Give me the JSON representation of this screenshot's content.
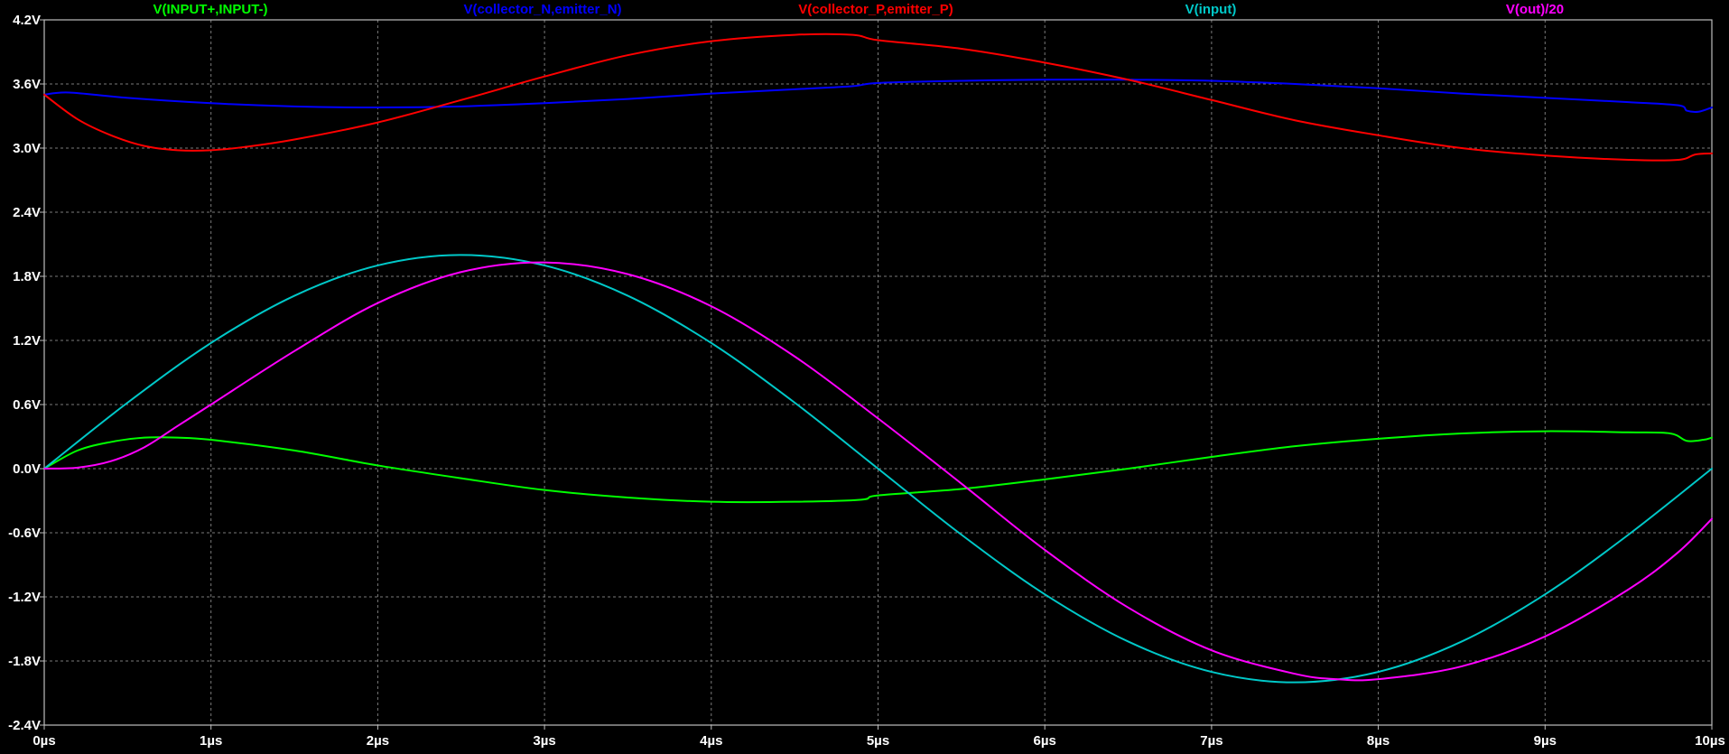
{
  "chart_data": {
    "type": "line",
    "title": "",
    "xlabel": "",
    "ylabel": "",
    "xlim": [
      0,
      10
    ],
    "ylim": [
      -2.4,
      4.2
    ],
    "x_unit": "µs",
    "y_unit": "V",
    "grid": true,
    "legend_position": "top",
    "x_ticks": [
      "0µs",
      "1µs",
      "2µs",
      "3µs",
      "4µs",
      "5µs",
      "6µs",
      "7µs",
      "8µs",
      "9µs",
      "10µs"
    ],
    "y_ticks": [
      "4.2V",
      "3.6V",
      "3.0V",
      "2.4V",
      "1.8V",
      "1.2V",
      "0.6V",
      "0.0V",
      "-0.6V",
      "-1.2V",
      "-1.8V",
      "-2.4V"
    ],
    "series": [
      {
        "name": "V(INPUT+,INPUT-)",
        "color": "#00ff00",
        "points": [
          [
            0,
            0
          ],
          [
            0.2,
            0.17
          ],
          [
            0.4,
            0.25
          ],
          [
            0.6,
            0.29
          ],
          [
            0.8,
            0.29
          ],
          [
            1.0,
            0.27
          ],
          [
            1.5,
            0.17
          ],
          [
            2.0,
            0.03
          ],
          [
            2.5,
            -0.09
          ],
          [
            3.0,
            -0.2
          ],
          [
            3.5,
            -0.27
          ],
          [
            4.0,
            -0.31
          ],
          [
            4.5,
            -0.31
          ],
          [
            4.9,
            -0.29
          ],
          [
            5.0,
            -0.25
          ],
          [
            5.5,
            -0.19
          ],
          [
            6.0,
            -0.1
          ],
          [
            6.5,
            0.0
          ],
          [
            7.0,
            0.11
          ],
          [
            7.5,
            0.21
          ],
          [
            8.0,
            0.28
          ],
          [
            8.5,
            0.33
          ],
          [
            9.0,
            0.35
          ],
          [
            9.5,
            0.34
          ],
          [
            9.75,
            0.33
          ],
          [
            9.85,
            0.26
          ],
          [
            9.95,
            0.27
          ],
          [
            10.0,
            0.29
          ]
        ]
      },
      {
        "name": "V(collector_N,emitter_N)",
        "color": "#0000ff",
        "points": [
          [
            0,
            3.5
          ],
          [
            0.15,
            3.52
          ],
          [
            0.5,
            3.47
          ],
          [
            1.0,
            3.42
          ],
          [
            1.5,
            3.39
          ],
          [
            2.0,
            3.38
          ],
          [
            2.5,
            3.39
          ],
          [
            3.0,
            3.42
          ],
          [
            3.5,
            3.46
          ],
          [
            4.0,
            3.51
          ],
          [
            4.5,
            3.55
          ],
          [
            4.85,
            3.58
          ],
          [
            5.0,
            3.61
          ],
          [
            5.5,
            3.63
          ],
          [
            6.0,
            3.64
          ],
          [
            6.5,
            3.64
          ],
          [
            7.0,
            3.63
          ],
          [
            7.5,
            3.6
          ],
          [
            8.0,
            3.56
          ],
          [
            8.5,
            3.51
          ],
          [
            9.0,
            3.47
          ],
          [
            9.5,
            3.43
          ],
          [
            9.8,
            3.4
          ],
          [
            9.85,
            3.35
          ],
          [
            9.92,
            3.34
          ],
          [
            10.0,
            3.38
          ]
        ]
      },
      {
        "name": "V(collector_P,emitter_P)",
        "color": "#ff0000",
        "points": [
          [
            0,
            3.5
          ],
          [
            0.2,
            3.27
          ],
          [
            0.4,
            3.12
          ],
          [
            0.6,
            3.02
          ],
          [
            0.8,
            2.98
          ],
          [
            1.0,
            2.98
          ],
          [
            1.2,
            3.01
          ],
          [
            1.5,
            3.08
          ],
          [
            2.0,
            3.24
          ],
          [
            2.5,
            3.45
          ],
          [
            3.0,
            3.67
          ],
          [
            3.5,
            3.87
          ],
          [
            4.0,
            4.0
          ],
          [
            4.5,
            4.06
          ],
          [
            4.85,
            4.06
          ],
          [
            5.0,
            4.01
          ],
          [
            5.5,
            3.93
          ],
          [
            6.0,
            3.8
          ],
          [
            6.5,
            3.64
          ],
          [
            7.0,
            3.45
          ],
          [
            7.5,
            3.26
          ],
          [
            8.0,
            3.12
          ],
          [
            8.5,
            3.0
          ],
          [
            9.0,
            2.93
          ],
          [
            9.5,
            2.89
          ],
          [
            9.8,
            2.89
          ],
          [
            9.9,
            2.94
          ],
          [
            10.0,
            2.95
          ]
        ]
      },
      {
        "name": "V(input)",
        "color": "#00c8c8",
        "points": [
          [
            0,
            0.0
          ],
          [
            0.5,
            0.618
          ],
          [
            1.0,
            1.176
          ],
          [
            1.5,
            1.618
          ],
          [
            2.0,
            1.902
          ],
          [
            2.5,
            2.0
          ],
          [
            3.0,
            1.902
          ],
          [
            3.5,
            1.618
          ],
          [
            4.0,
            1.176
          ],
          [
            4.5,
            0.618
          ],
          [
            5.0,
            0.0
          ],
          [
            5.5,
            -0.618
          ],
          [
            6.0,
            -1.176
          ],
          [
            6.5,
            -1.618
          ],
          [
            7.0,
            -1.902
          ],
          [
            7.5,
            -2.0
          ],
          [
            8.0,
            -1.902
          ],
          [
            8.5,
            -1.618
          ],
          [
            9.0,
            -1.176
          ],
          [
            9.5,
            -0.618
          ],
          [
            10.0,
            0.0
          ]
        ]
      },
      {
        "name": "V(out)/20",
        "color": "#ff00ff",
        "points": [
          [
            0,
            0.0
          ],
          [
            0.2,
            0.01
          ],
          [
            0.4,
            0.07
          ],
          [
            0.6,
            0.2
          ],
          [
            0.8,
            0.4
          ],
          [
            1.0,
            0.6
          ],
          [
            1.5,
            1.1
          ],
          [
            2.0,
            1.55
          ],
          [
            2.5,
            1.84
          ],
          [
            3.0,
            1.93
          ],
          [
            3.5,
            1.82
          ],
          [
            4.0,
            1.52
          ],
          [
            4.5,
            1.05
          ],
          [
            5.0,
            0.47
          ],
          [
            5.5,
            -0.14
          ],
          [
            6.0,
            -0.76
          ],
          [
            6.5,
            -1.3
          ],
          [
            7.0,
            -1.7
          ],
          [
            7.5,
            -1.92
          ],
          [
            7.75,
            -1.97
          ],
          [
            8.0,
            -1.97
          ],
          [
            8.5,
            -1.85
          ],
          [
            9.0,
            -1.57
          ],
          [
            9.5,
            -1.13
          ],
          [
            9.8,
            -0.78
          ],
          [
            10.0,
            -0.47
          ]
        ]
      }
    ]
  }
}
